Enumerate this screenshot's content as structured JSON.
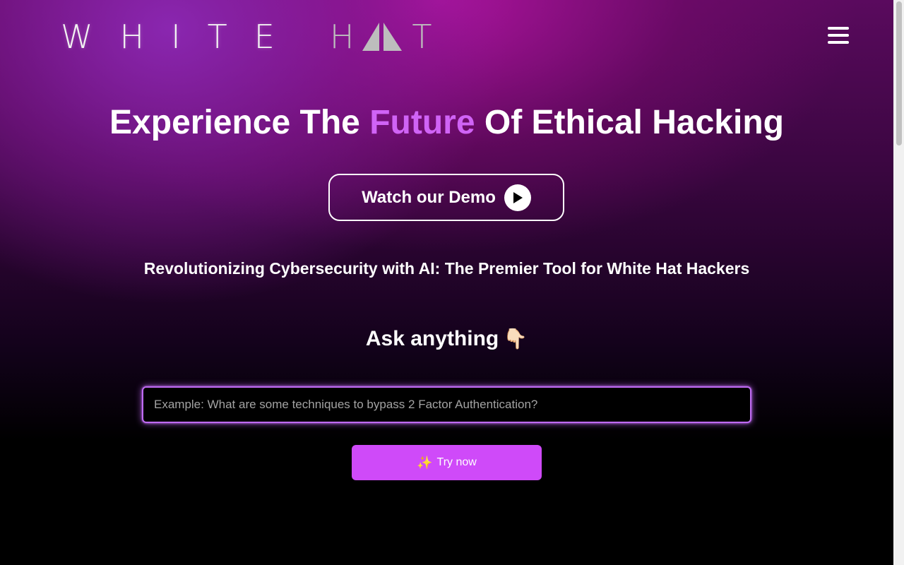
{
  "header": {
    "logo_part1": "WHITE",
    "logo_part2_letter_h": "H",
    "logo_part2_letter_t": "T",
    "logo_hat_icon": "hat-triangle-icon",
    "menu_icon": "hamburger-menu-icon"
  },
  "hero": {
    "title_before": "Experience The ",
    "title_accent": "Future",
    "title_after": " Of Ethical Hacking",
    "demo_button_label": "Watch our Demo",
    "demo_button_icon": "play-circle-icon",
    "tagline": "Revolutionizing Cybersecurity with AI: The Premier Tool for White Hat Hackers"
  },
  "ask": {
    "heading": "Ask anything",
    "heading_emoji": "👇🏻",
    "input_placeholder": "Example: What are some techniques to bypass 2 Factor Authentication?",
    "input_value": "",
    "try_button_icon": "✨",
    "try_button_label": "Try now"
  },
  "colors": {
    "accent_text": "#d063f6",
    "try_button_bg": "#cf4af9",
    "input_border": "#c06bf3"
  }
}
